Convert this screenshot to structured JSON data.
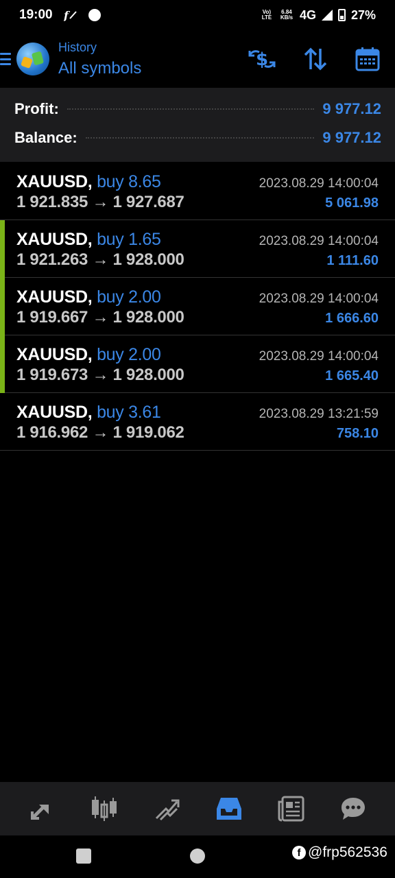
{
  "status_bar": {
    "time": "19:00",
    "volte": "Vo) LTE",
    "speed": "6.84 KB/s",
    "network": "4G",
    "battery": "27%"
  },
  "header": {
    "subtitle": "History",
    "title": "All symbols",
    "icons": [
      "menu-icon",
      "currency-switch-icon",
      "sort-icon",
      "calendar-icon"
    ]
  },
  "summary": {
    "profit_label": "Profit:",
    "profit_value": "9 977.12",
    "balance_label": "Balance:",
    "balance_value": "9 977.12"
  },
  "deals": [
    {
      "symbol": "XAUUSD,",
      "side": "buy 8.65",
      "prices": "1 921.835 → 1 927.687",
      "time": "2023.08.29 14:00:04",
      "profit": "5 061.98",
      "marked": false
    },
    {
      "symbol": "XAUUSD,",
      "side": "buy 1.65",
      "prices": "1 921.263 → 1 928.000",
      "time": "2023.08.29 14:00:04",
      "profit": "1 111.60",
      "marked": true
    },
    {
      "symbol": "XAUUSD,",
      "side": "buy 2.00",
      "prices": "1 919.667 → 1 928.000",
      "time": "2023.08.29 14:00:04",
      "profit": "1 666.60",
      "marked": true
    },
    {
      "symbol": "XAUUSD,",
      "side": "buy 2.00",
      "prices": "1 919.673 → 1 928.000",
      "time": "2023.08.29 14:00:04",
      "profit": "1 665.40",
      "marked": true
    },
    {
      "symbol": "XAUUSD,",
      "side": "buy 3.61",
      "prices": "1 916.962 → 1 919.062",
      "time": "2023.08.29 13:21:59",
      "profit": "758.10",
      "marked": false
    }
  ],
  "bottom_nav": {
    "items": [
      "quotes-icon",
      "chart-icon",
      "trade-icon",
      "history-icon",
      "news-icon",
      "messages-icon"
    ],
    "active": "history-icon",
    "active_color": "#3b87e6"
  },
  "watermark": {
    "icon_letter": "f",
    "handle": "@frp562536"
  }
}
